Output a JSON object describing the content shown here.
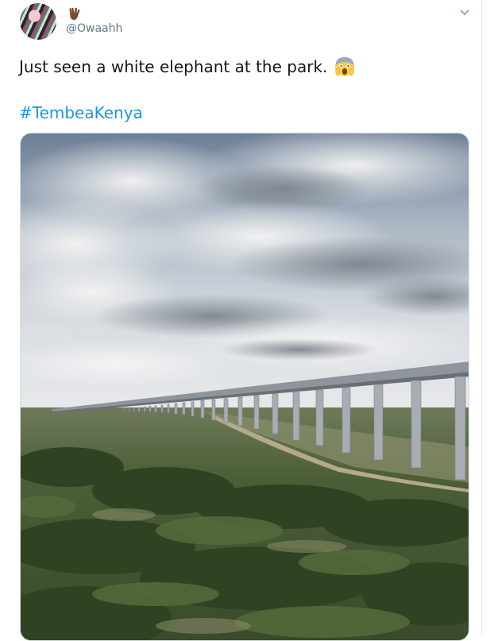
{
  "user": {
    "handle": "@Owaahh",
    "name_emoji": "vulcan-salute-hand"
  },
  "tweet": {
    "text": "Just seen a white elephant at the park.",
    "emoji": "face-screaming-in-fear",
    "hashtag": "#TembeaKenya"
  },
  "media": {
    "alt": "Elevated railway viaduct crossing a green park under a cloudy sky"
  },
  "colors": {
    "link": "#1b95e0",
    "text": "#14171a",
    "secondary": "#657786"
  }
}
